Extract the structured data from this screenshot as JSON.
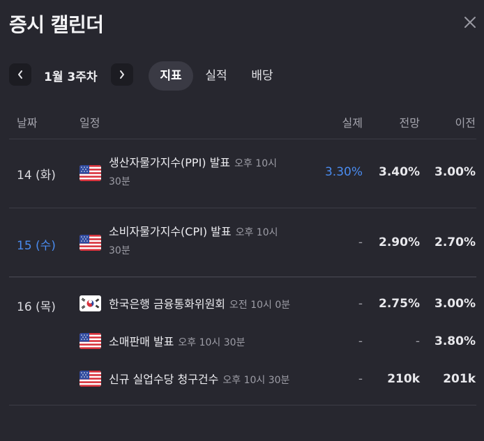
{
  "header": {
    "title": "증시 캘린더"
  },
  "nav": {
    "week_label": "1월 3주차",
    "tabs": [
      {
        "label": "지표",
        "active": true
      },
      {
        "label": "실적",
        "active": false
      },
      {
        "label": "배당",
        "active": false
      }
    ]
  },
  "table": {
    "columns": {
      "date": "날짜",
      "event": "일정",
      "actual": "실제",
      "forecast": "전망",
      "previous": "이전"
    },
    "rows": [
      {
        "date": "14 (화)",
        "flag": "us-flag-icon",
        "name": "생산자물가지수(PPI) 발표",
        "time_a": "오후 10시",
        "time_b": "30분",
        "actual": "3.30%",
        "forecast": "3.40%",
        "previous": "3.00%"
      },
      {
        "date": "15 (수)",
        "flag": "us-flag-icon",
        "name": "소비자물가지수(CPI) 발표",
        "time_a": "오후 10시",
        "time_b": "30분",
        "actual": "-",
        "forecast": "2.90%",
        "previous": "2.70%"
      },
      {
        "date": "16 (목)",
        "flag": "kr-flag-icon",
        "name": "한국은행 금융통화위원회",
        "time": "오전 10시 0분",
        "actual": "-",
        "forecast": "2.75%",
        "previous": "3.00%"
      },
      {
        "date": "",
        "flag": "us-flag-icon",
        "name": "소매판매 발표",
        "time": "오후 10시 30분",
        "actual": "-",
        "forecast": "-",
        "previous": "3.80%"
      },
      {
        "date": "",
        "flag": "us-flag-icon",
        "name": "신규 실업수당 청구건수",
        "time": "오후 10시 30분",
        "actual": "-",
        "forecast": "210k",
        "previous": "201k"
      }
    ]
  },
  "colors": {
    "background": "#27272f",
    "accent_blue": "#4a8cf0",
    "active_tab": "#3a3a44"
  }
}
